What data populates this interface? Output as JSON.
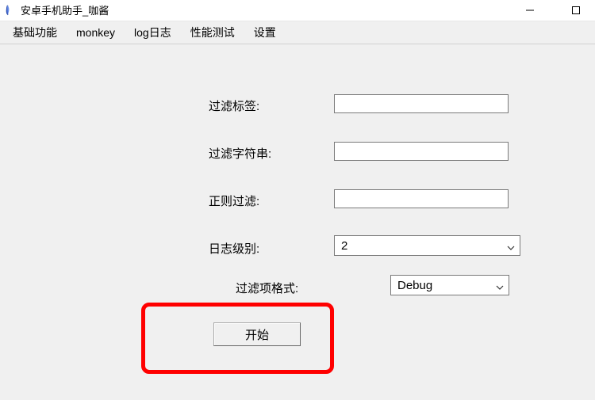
{
  "window": {
    "title": "安卓手机助手_咖酱"
  },
  "menu": {
    "items": [
      {
        "label": "基础功能"
      },
      {
        "label": "monkey"
      },
      {
        "label": "log日志"
      },
      {
        "label": "性能测试"
      },
      {
        "label": "设置"
      }
    ]
  },
  "form": {
    "filter_tag_label": "过滤标签:",
    "filter_tag_value": "",
    "filter_string_label": "过滤字符串:",
    "filter_string_value": "",
    "regex_filter_label": "正则过滤:",
    "regex_filter_value": "",
    "log_level_label": "日志级别:",
    "log_level_value": "2",
    "filter_format_label": "过滤项格式:",
    "filter_format_value": "Debug",
    "start_button_label": "开始"
  }
}
